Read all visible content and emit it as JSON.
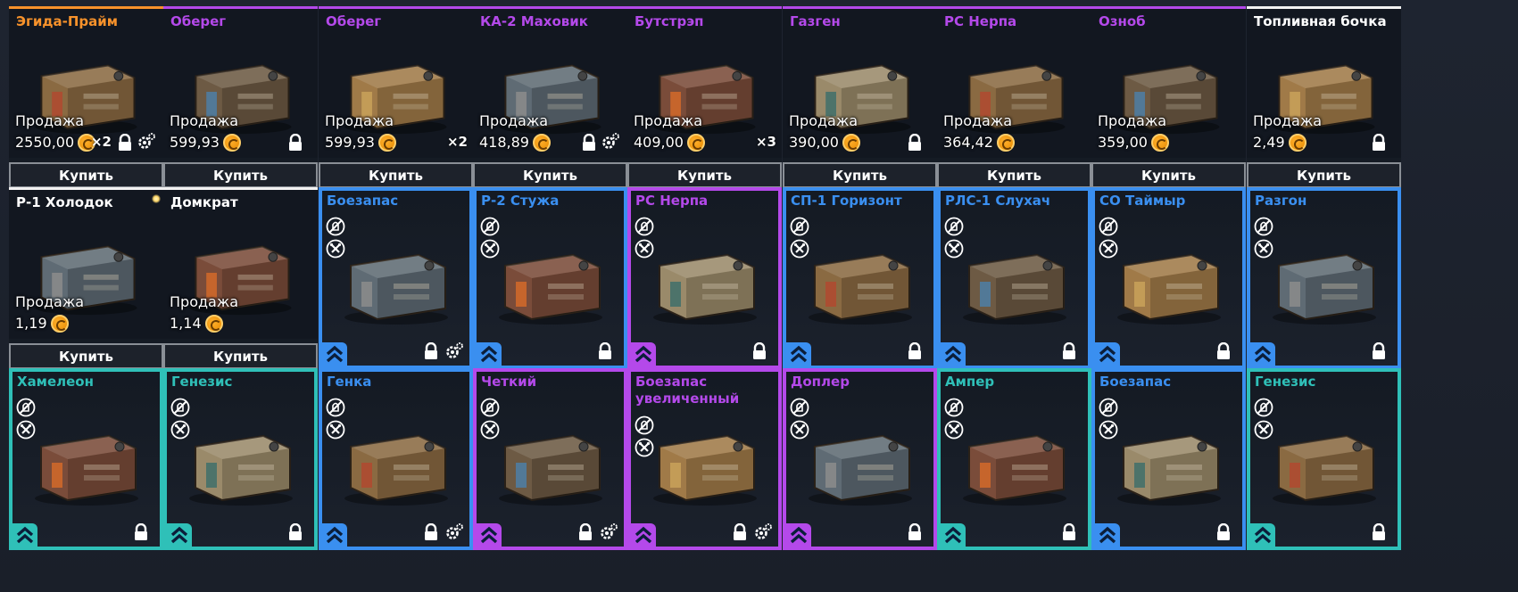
{
  "colors": {
    "orange": "#f7922b",
    "purple": "#b449ea",
    "white": "#f2f2f2",
    "blue": "#3a8ff0",
    "teal": "#2fc0b8"
  },
  "buy_label": "Купить",
  "sell_label": "Продажа",
  "shop_items": [
    {
      "title": "Эгида-Прайм",
      "rarity": "orange",
      "price": "2550,00",
      "qty": "×2",
      "locked": true,
      "craft": true
    },
    {
      "title": "Оберег",
      "rarity": "purple",
      "price": "599,93",
      "qty": "",
      "locked": true,
      "craft": false
    },
    {
      "title": "Оберег",
      "rarity": "purple",
      "price": "599,93",
      "qty": "×2",
      "locked": false,
      "craft": false
    },
    {
      "title": "КА-2 Маховик",
      "rarity": "purple",
      "price": "418,89",
      "qty": "",
      "locked": true,
      "craft": true
    },
    {
      "title": "Бутстрэп",
      "rarity": "purple",
      "price": "409,00",
      "qty": "×3",
      "locked": false,
      "craft": false
    },
    {
      "title": "Газген",
      "rarity": "purple",
      "price": "390,00",
      "qty": "",
      "locked": true,
      "craft": false
    },
    {
      "title": "РС Нерпа",
      "rarity": "purple",
      "price": "364,42",
      "qty": "",
      "locked": false,
      "craft": false
    },
    {
      "title": "Озноб",
      "rarity": "purple",
      "price": "359,00",
      "qty": "",
      "locked": false,
      "craft": false
    },
    {
      "title": "Топливная бочка",
      "rarity": "white",
      "price": "2,49",
      "qty": "",
      "locked": true,
      "craft": false
    },
    {
      "title": "Р-1 Холодок",
      "rarity": "white",
      "price": "1,19",
      "qty": "",
      "locked": false,
      "craft": false
    },
    {
      "title": "Домкрат",
      "rarity": "white",
      "price": "1,14",
      "qty": "",
      "locked": false,
      "craft": false
    }
  ],
  "inventory_items": [
    {
      "title": "Боезапас",
      "rarity": "blue",
      "locked": true,
      "craft": true
    },
    {
      "title": "Р-2 Стужа",
      "rarity": "blue",
      "locked": true,
      "craft": false
    },
    {
      "title": "РС Нерпа",
      "rarity": "purple",
      "locked": true,
      "craft": false
    },
    {
      "title": "СП-1 Горизонт",
      "rarity": "blue",
      "locked": true,
      "craft": false
    },
    {
      "title": "РЛС-1 Слухач",
      "rarity": "blue",
      "locked": true,
      "craft": false
    },
    {
      "title": "СО Таймыр",
      "rarity": "blue",
      "locked": true,
      "craft": false
    },
    {
      "title": "Разгон",
      "rarity": "blue",
      "locked": true,
      "craft": false
    },
    {
      "title": "Хамелеон",
      "rarity": "teal",
      "locked": true,
      "craft": false
    },
    {
      "title": "Генезис",
      "rarity": "teal",
      "locked": true,
      "craft": false
    },
    {
      "title": "Генка",
      "rarity": "blue",
      "locked": true,
      "craft": true
    },
    {
      "title": "Четкий",
      "rarity": "purple",
      "locked": true,
      "craft": true
    },
    {
      "title": "Боезапас увеличенный",
      "rarity": "purple",
      "locked": true,
      "craft": true
    },
    {
      "title": "Доплер",
      "rarity": "purple",
      "locked": true,
      "craft": false
    },
    {
      "title": "Ампер",
      "rarity": "teal",
      "locked": true,
      "craft": false
    },
    {
      "title": "Боезапас",
      "rarity": "blue",
      "locked": true,
      "craft": false
    },
    {
      "title": "Генезис",
      "rarity": "teal",
      "locked": true,
      "craft": false
    }
  ]
}
